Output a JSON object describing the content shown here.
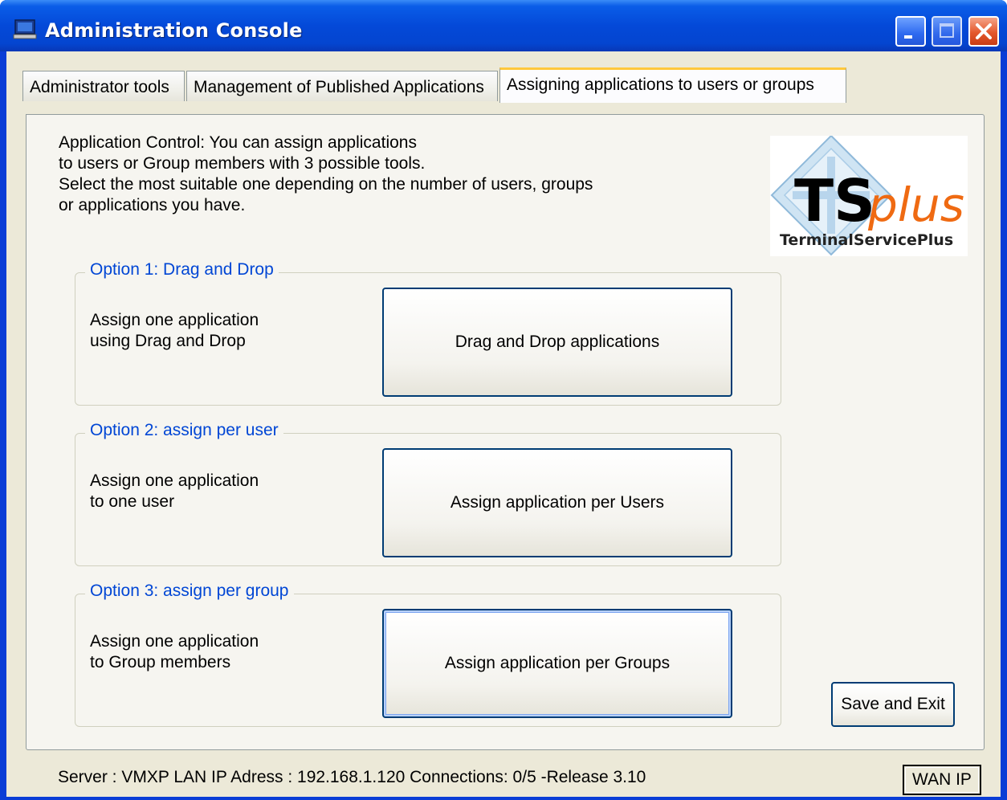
{
  "window": {
    "title": "Administration Console",
    "colors": {
      "titlebar": "#0449d8",
      "accent_tab": "#ffc83c",
      "groupbox_title": "#0046d5",
      "logo_ts": "#000000",
      "logo_plus": "#ef6a12"
    }
  },
  "tabs": [
    {
      "label": "Administrator tools",
      "active": false
    },
    {
      "label": "Management of Published Applications",
      "active": false
    },
    {
      "label": "Assigning applications to users or groups",
      "active": true
    }
  ],
  "description": {
    "line1": "Application Control: You can assign applications",
    "line2": "to users or Group members with 3 possible tools.",
    "line3": "Select the most suitable one depending on the number of users, groups",
    "line4": "or applications you have."
  },
  "logo": {
    "ts": "TS",
    "plus": "plus",
    "caption": "TerminalServicePlus"
  },
  "options": [
    {
      "title": "Option 1: Drag and Drop",
      "text1": "Assign one application",
      "text2": "using Drag and Drop",
      "button": "Drag and Drop applications"
    },
    {
      "title": "Option 2: assign per user",
      "text1": "Assign one application",
      "text2": "to one user",
      "button": "Assign application per Users"
    },
    {
      "title": "Option 3: assign per group",
      "text1": "Assign one application",
      "text2": "to Group members",
      "button": "Assign application per Groups"
    }
  ],
  "save_button": "Save and Exit",
  "status": {
    "text": "Server : VMXP LAN IP Adress : 192.168.1.120 Connections: 0/5  -Release 3.10"
  },
  "wan_button": "WAN IP"
}
